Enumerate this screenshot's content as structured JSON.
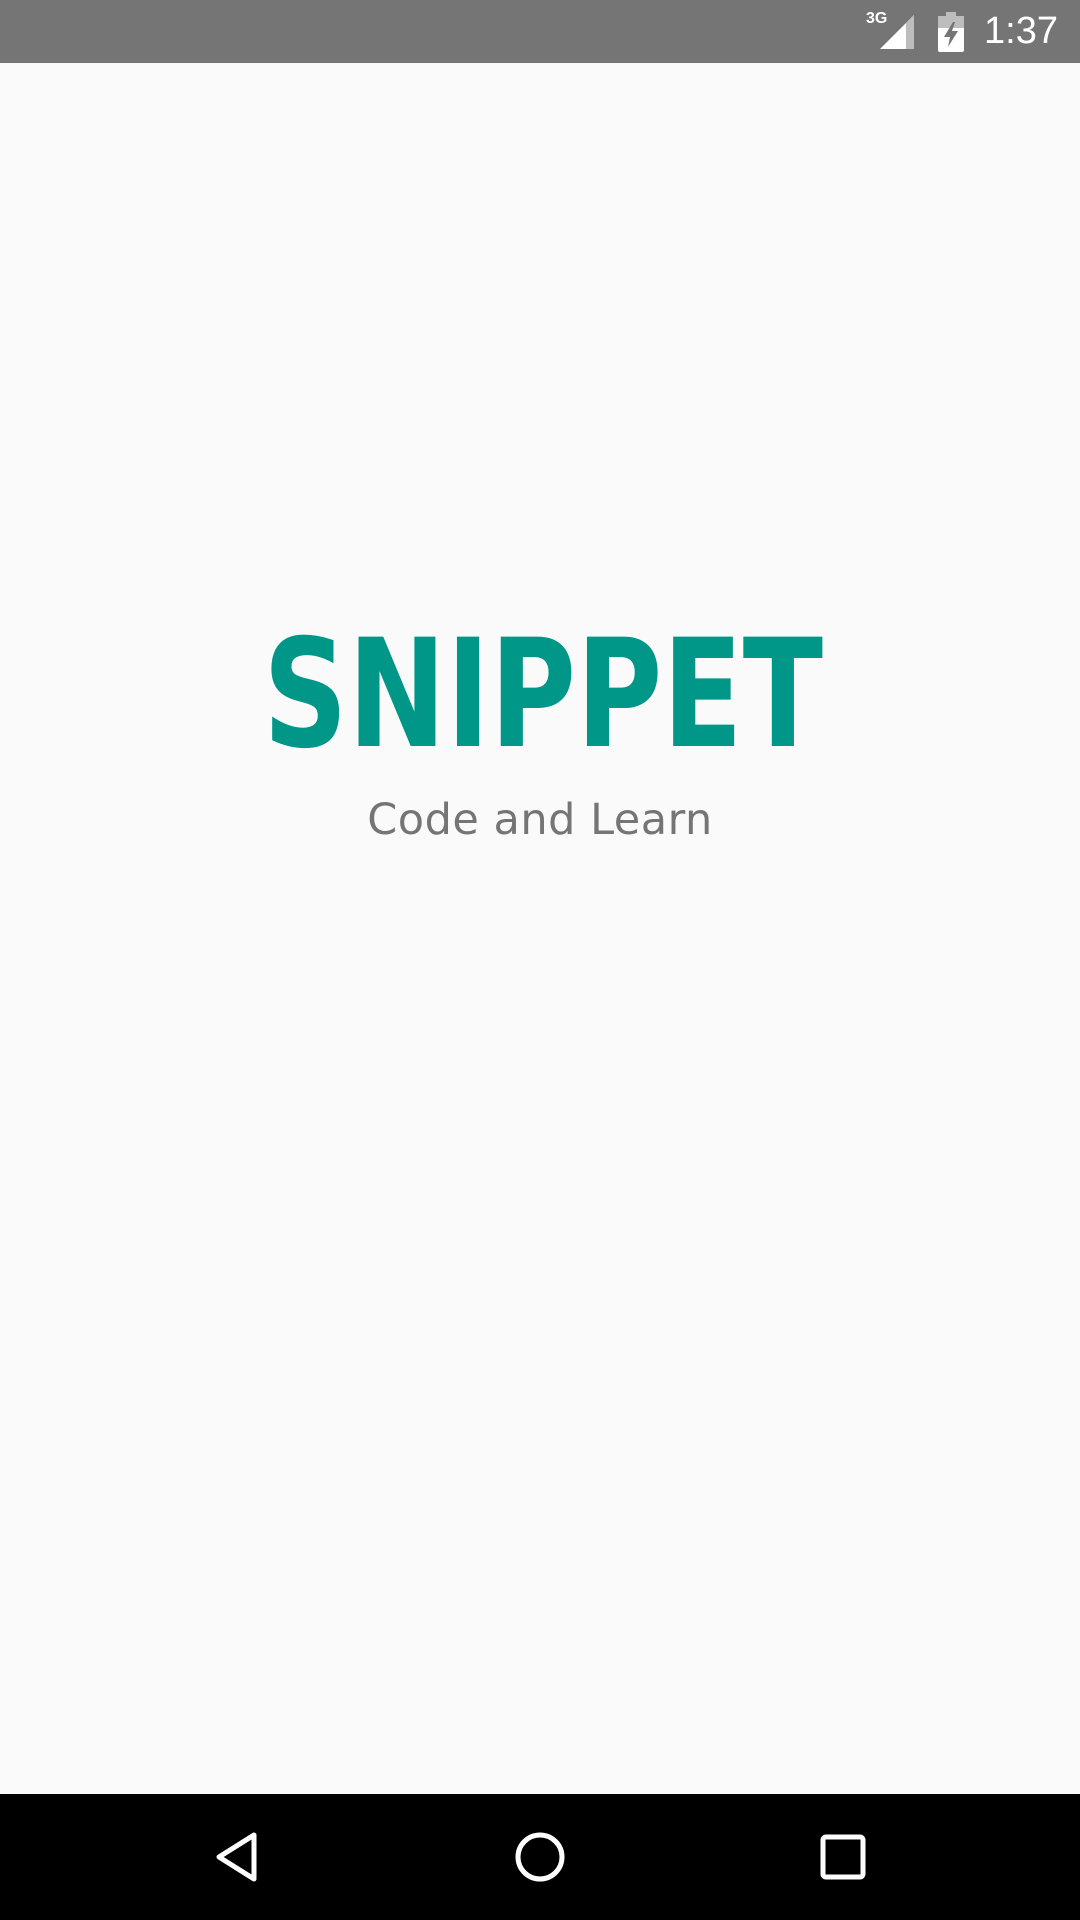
{
  "status_bar": {
    "network_type": "3G",
    "time": "1:37",
    "icons": [
      "signal-icon",
      "battery-charging-icon"
    ]
  },
  "splash": {
    "logo_text": "SNIPPET",
    "tagline": "Code and Learn",
    "brand_color": "#009688",
    "tagline_color": "#757575"
  },
  "nav_bar": {
    "buttons": [
      "back-icon",
      "home-icon",
      "recents-icon"
    ]
  },
  "colors": {
    "status_bar": "#757575",
    "background": "#fafafa",
    "nav_bar": "#000000"
  }
}
